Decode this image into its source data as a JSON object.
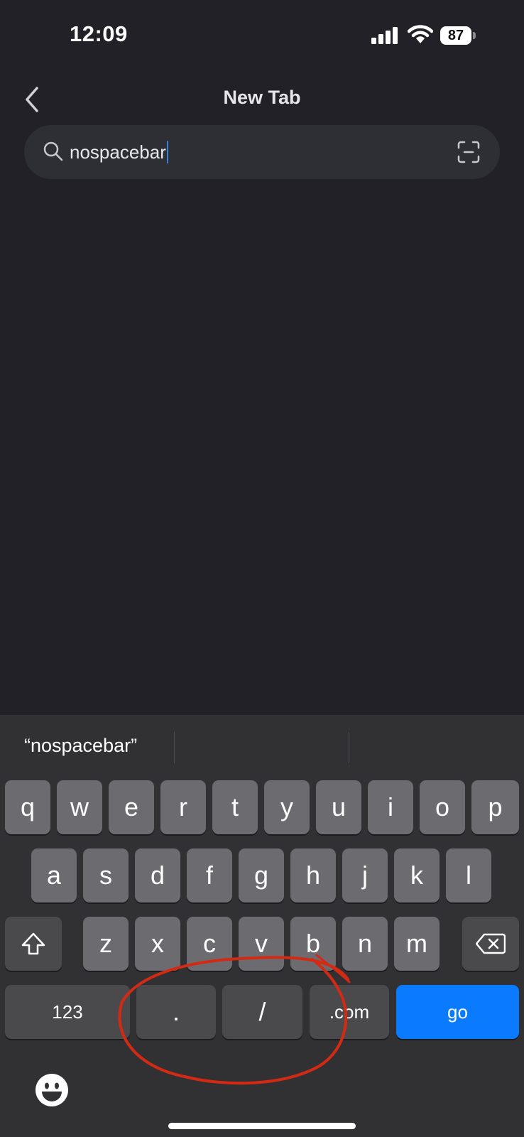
{
  "status_bar": {
    "time": "12:09",
    "battery": "87",
    "signal_icon": "cellular-signal-icon",
    "wifi_icon": "wifi-icon"
  },
  "header": {
    "title": "New Tab",
    "back_icon": "chevron-left-icon"
  },
  "search": {
    "value": "nospacebar",
    "search_icon": "magnifier-icon",
    "scan_icon": "scan-icon"
  },
  "keyboard": {
    "suggestions": [
      "“nospacebar”",
      "",
      ""
    ],
    "row1": [
      "q",
      "w",
      "e",
      "r",
      "t",
      "y",
      "u",
      "i",
      "o",
      "p"
    ],
    "row2": [
      "a",
      "s",
      "d",
      "f",
      "g",
      "h",
      "j",
      "k",
      "l"
    ],
    "row3": [
      "z",
      "x",
      "c",
      "v",
      "b",
      "n",
      "m"
    ],
    "shift_icon": "shift-icon",
    "delete_icon": "backspace-icon",
    "bottom_row": {
      "numbers": "123",
      "dot": ".",
      "slash": "/",
      "dotcom": ".com",
      "go": "go"
    },
    "emoji_icon": "emoji-icon"
  },
  "colors": {
    "background": "#212127",
    "search_bar": "#2e2e35",
    "keyboard_bg": "#313134",
    "key": "#6c6c70",
    "key_dark": "#4a4a4d",
    "go_key": "#0a7bff",
    "annotation": "#d42a14"
  }
}
